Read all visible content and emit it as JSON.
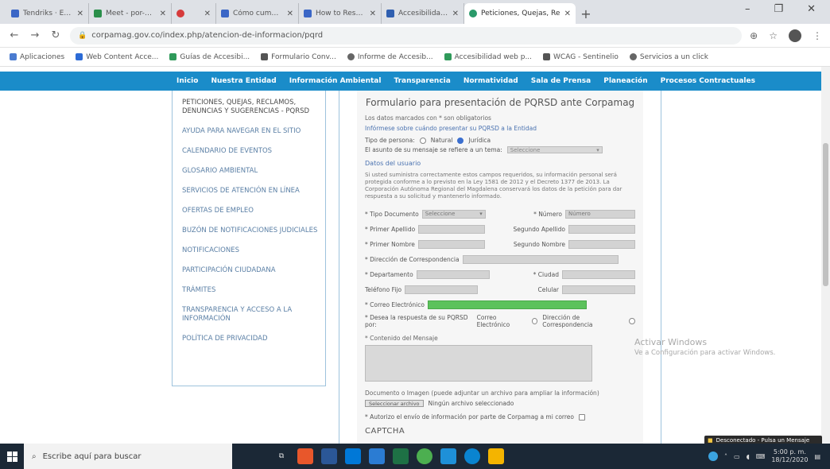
{
  "browser": {
    "tabs": [
      {
        "label": "Tendriks · Expedientes",
        "color": "#3a66c6"
      },
      {
        "label": "Meet - por-wasinj",
        "color": "#2a8f4a"
      },
      {
        "label": "",
        "color": "#d63b3b"
      },
      {
        "label": "Cómo cumplir con el",
        "color": "#3a66c6"
      },
      {
        "label": "How to Reset NetS",
        "color": "#3a66c6"
      },
      {
        "label": "Accesibilidad Web",
        "color": "#2f5fb0"
      },
      {
        "label": "Peticiones, Quejas, Re",
        "color": "#2a9a6a"
      }
    ],
    "url": "corpamag.gov.co/index.php/atencion-de-informacion/pqrd",
    "bookmarks": [
      {
        "label": "Aplicaciones",
        "color": "#4a7bd0"
      },
      {
        "label": "Web Content Acce...",
        "color": "#2c6bd6"
      },
      {
        "label": "Guías de Accesibi...",
        "color": "#2f9a5a"
      },
      {
        "label": "Formulario Conv...",
        "color": "#555555"
      },
      {
        "label": "Informe de Accesib...",
        "color": "#666666"
      },
      {
        "label": "Accesibilidad web p...",
        "color": "#2f9a5a"
      },
      {
        "label": "WCAG - Sentinelio",
        "color": "#555555"
      },
      {
        "label": "Servicios a un click",
        "color": "#666666"
      }
    ]
  },
  "site": {
    "nav": [
      "Inicio",
      "Nuestra Entidad",
      "Información Ambiental",
      "Transparencia",
      "Normatividad",
      "Sala de Prensa",
      "Planeación",
      "Procesos Contractuales"
    ],
    "sidebar": [
      "Peticiones, quejas, reclamos, denuncias y sugerencias - PQRSD",
      "Ayuda para navegar en el sitio",
      "Calendario de eventos",
      "Glosario ambiental",
      "Servicios de atención en línea",
      "Ofertas de empleo",
      "Buzón de notificaciones judiciales",
      "Notificaciones",
      "Participación ciudadana",
      "Trámites",
      "Transparencia y acceso a la información",
      "Política de privacidad"
    ],
    "form": {
      "title": "Formulario para presentación de PQRSD ante Corpamag",
      "required_note": "Los datos marcados con * son obligatorios",
      "help_link": "Infórmese sobre cuándo presentar su PQRSD a la Entidad",
      "person_label": "Tipo de persona:",
      "person_options": [
        "Natural",
        "Jurídica"
      ],
      "topic_label": "El asunto de su mensaje se refiere a un tema:",
      "topic_value": "Seleccione",
      "section_user": "Datos del usuario",
      "paragraph": "Si usted suministra correctamente estos campos requeridos, su información personal será protegida conforme a lo previsto en la Ley 1581 de 2012 y el Decreto 1377 de 2013. La Corporación Autónoma Regional del Magdalena conservará los datos de la petición para dar respuesta a su solicitud y mantenerlo informado.",
      "doc_type_label": "* Tipo Documento",
      "doc_type_value": "Seleccione",
      "doc_num_label": "* Número",
      "doc_num_value": "Número",
      "first_surname_label": "* Primer Apellido",
      "second_surname_label": "Segundo Apellido",
      "first_name_label": "* Primer Nombre",
      "second_name_label": "Segundo Nombre",
      "address_label": "* Dirección de Correspondencia",
      "department_label": "* Departamento",
      "city_label": "* Ciudad",
      "phone_label": "Teléfono Fijo",
      "mobile_label": "Celular",
      "email_label": "* Correo Electrónico",
      "response_label": "* Desea la respuesta de su PQRSD por:",
      "response_options": [
        "Correo Electrónico",
        "Dirección de Correspondencia"
      ],
      "message_label": "* Contenido del Mensaje",
      "attachment_label": "Documento o Imagen (puede adjuntar un archivo para ampliar la información)",
      "file_button": "Seleccionar archivo",
      "file_status": "Ningún archivo seleccionado",
      "consent_label": "* Autorizo el envío de información por parte de Corpamag a mi correo",
      "captcha": "CAPTCHA"
    }
  },
  "windows": {
    "activate_title": "Activar Windows",
    "activate_sub": "Ve a Configuración para activar Windows.",
    "toast": "Desconectado - Pulsa un Mensaje",
    "search_placeholder": "Escribe aquí para buscar",
    "time": "5:00 p. m.",
    "date": "18/12/2020"
  }
}
